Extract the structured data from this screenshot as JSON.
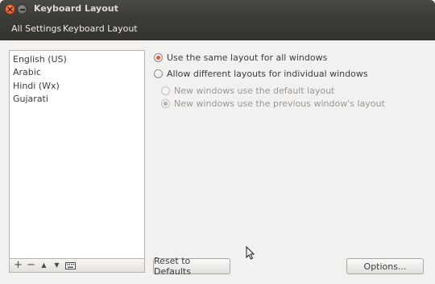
{
  "window": {
    "title": "Keyboard Layout"
  },
  "navbar": {
    "all_settings": "All Settings",
    "current": "Keyboard Layout"
  },
  "layouts": [
    "English (US)",
    "Arabic",
    "Hindi (Wx)",
    "Gujarati"
  ],
  "list_toolbar": {
    "add": "+",
    "remove": "−",
    "up": "▲",
    "down": "▼"
  },
  "options": {
    "same_layout": {
      "label": "Use the same layout for all windows",
      "checked": true
    },
    "different_layouts": {
      "label": "Allow different layouts for individual windows",
      "checked": false
    },
    "new_default": {
      "label": "New windows use the default layout",
      "checked": false,
      "enabled": false
    },
    "new_previous": {
      "label": "New windows use the previous window's layout",
      "checked": true,
      "enabled": false
    }
  },
  "buttons": {
    "reset": "Reset to Defaults",
    "options": "Options..."
  },
  "colors": {
    "accent": "#e05a2b",
    "titlebar": "#3c3b37"
  }
}
